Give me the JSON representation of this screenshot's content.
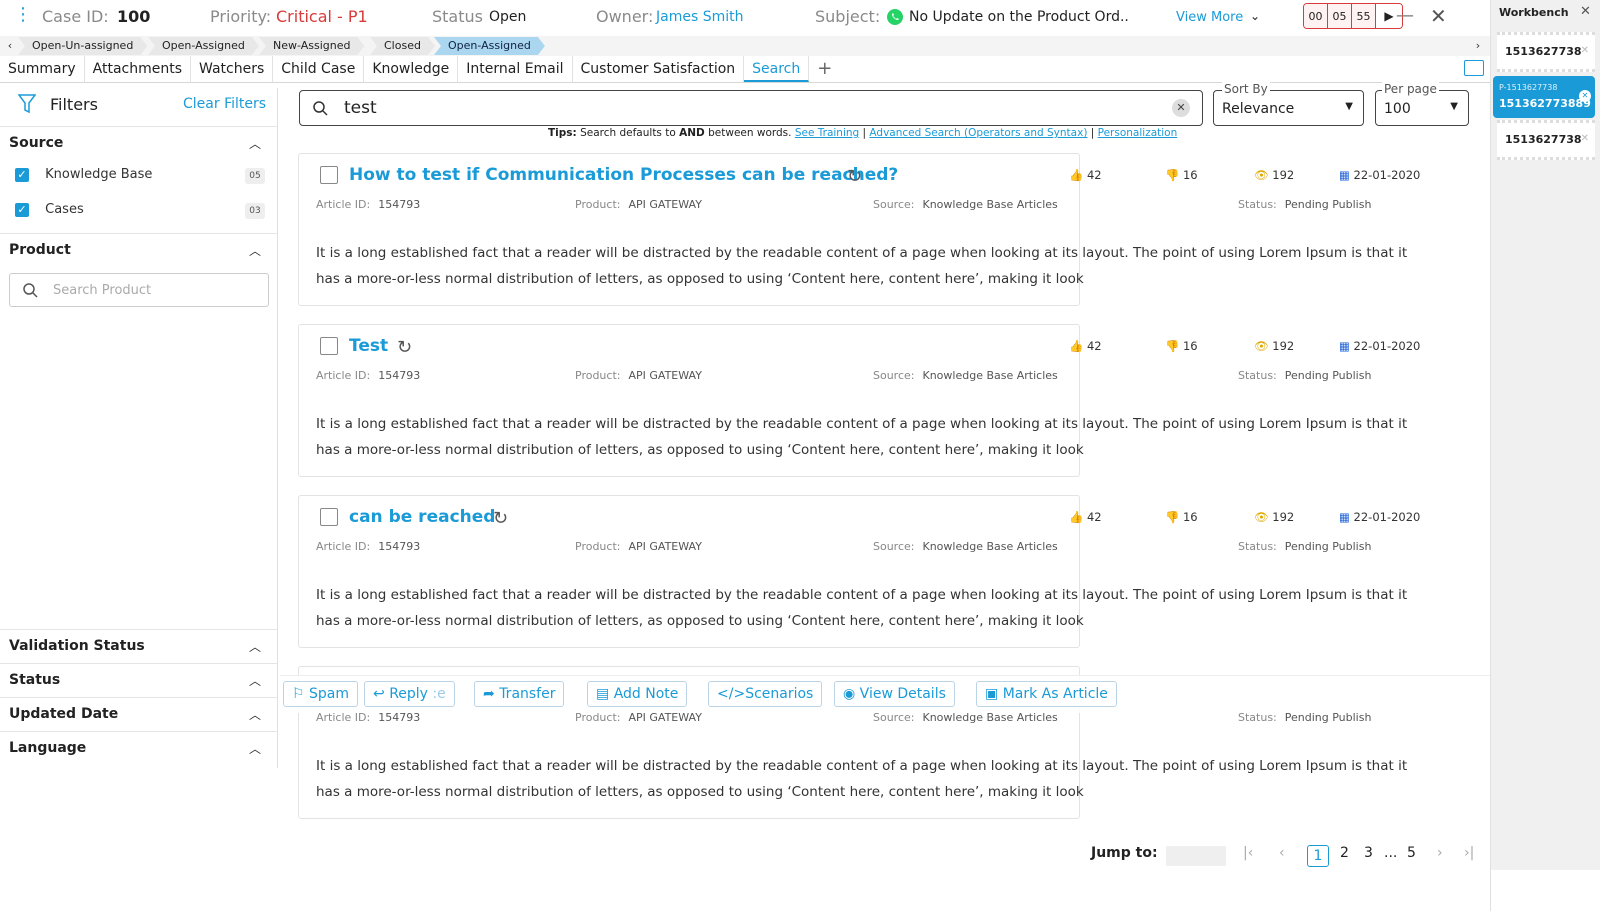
{
  "header": {
    "case_id_label": "Case ID:",
    "case_id": "100",
    "priority_label": "Priority:",
    "priority": "Critical - P1",
    "status_label": "Status",
    "status": "Open",
    "owner_label": "Owner:",
    "owner": "James Smith",
    "subject_label": "Subject:",
    "subject": "No Update on the Product Ord..",
    "view_more": "View More",
    "timer": [
      "00",
      "05",
      "55"
    ],
    "colors": {
      "accent": "#1a9bd7",
      "priority": "#d93a3a",
      "whatsapp": "#25d366"
    }
  },
  "statusbar": [
    "Open-Un-assigned",
    "Open-Assigned",
    "New-Assigned",
    "Closed",
    "Open-Assigned"
  ],
  "tabs": [
    "Summary",
    "Attachments",
    "Watchers",
    "Child Case",
    "Knowledge",
    "Internal Email",
    "Customer Satisfaction",
    "Search"
  ],
  "filters": {
    "title": "Filters",
    "clear": "Clear Filters",
    "source_title": "Source",
    "source_items": [
      {
        "label": "Knowledge Base",
        "count": "05"
      },
      {
        "label": "Cases",
        "count": "03"
      }
    ],
    "product_title": "Product",
    "product_placeholder": "Search Product",
    "validation_title": "Validation Status",
    "status_title": "Status",
    "updated_title": "Updated Date",
    "language_title": "Language"
  },
  "search": {
    "query": "test",
    "sort_label": "Sort By",
    "sort_value": "Relevance",
    "perpage_label": "Per page",
    "perpage_value": "100",
    "tips_prefix": "Tips:",
    "tips_text": "Search defaults to",
    "tips_and": "AND",
    "tips_text2": "between words.",
    "link_training": "See Training",
    "link_advanced": "Advanced Search (Operators and Syntax)",
    "link_personal": "Personalization"
  },
  "labels": {
    "article_id": "Article ID:",
    "product": "Product:",
    "source": "Source:",
    "status": "Status:"
  },
  "results": [
    {
      "title": "How to test if Communication Processes can be reached?",
      "likes": "42",
      "dislikes": "16",
      "views": "192",
      "date": "22-01-2020",
      "article_id": "154793",
      "product": "API GATEWAY",
      "source": "Knowledge Base Articles",
      "status": "Pending Publish",
      "description": "It is a long established fact that a reader will be distracted by the readable content of a page when looking at its layout. The point of using Lorem Ipsum is that it has a more-or-less normal distribution of letters, as opposed to using ‘Content here, content here’, making it look"
    },
    {
      "title": "Test",
      "likes": "42",
      "dislikes": "16",
      "views": "192",
      "date": "22-01-2020",
      "article_id": "154793",
      "product": "API GATEWAY",
      "source": "Knowledge Base Articles",
      "status": "Pending Publish",
      "description": "It is a long established fact that a reader will be distracted by the readable content of a page when looking at its layout. The point of using Lorem Ipsum is that it has a more-or-less normal distribution of letters, as opposed to using ‘Content here, content here’, making it look"
    },
    {
      "title": "can be reached",
      "likes": "42",
      "dislikes": "16",
      "views": "192",
      "date": "22-01-2020",
      "article_id": "154793",
      "product": "API GATEWAY",
      "source": "Knowledge Base Articles",
      "status": "Pending Publish",
      "description": "It is a long established fact that a reader will be distracted by the readable content of a page when looking at its layout. The point of using Lorem Ipsum is that it has a more-or-less normal distribution of letters, as opposed to using ‘Content here, content here’, making it look"
    },
    {
      "article_id": "154793",
      "product": "API GATEWAY",
      "source": "Knowledge Base Articles",
      "status": "Pending Publish",
      "description": "It is a long established fact that a reader will be distracted by the readable content of a page when looking at its layout. The point of using Lorem Ipsum is that it has a more-or-less normal distribution of letters, as opposed to using ‘Content here, content here’, making it look"
    }
  ],
  "actions": [
    "Spam",
    "Reply",
    "Transfer",
    "Add Note",
    "Scenarios",
    "View Details",
    "Mark As Article"
  ],
  "pagination": {
    "jump_label": "Jump to:",
    "pages": [
      "1",
      "2",
      "3",
      "...",
      "5"
    ]
  },
  "workbench": {
    "title": "Workbench",
    "items": [
      "1513627738",
      "1513627738",
      "1513627738"
    ],
    "active_small": "P-1513627738",
    "active_big": "151362773889"
  }
}
